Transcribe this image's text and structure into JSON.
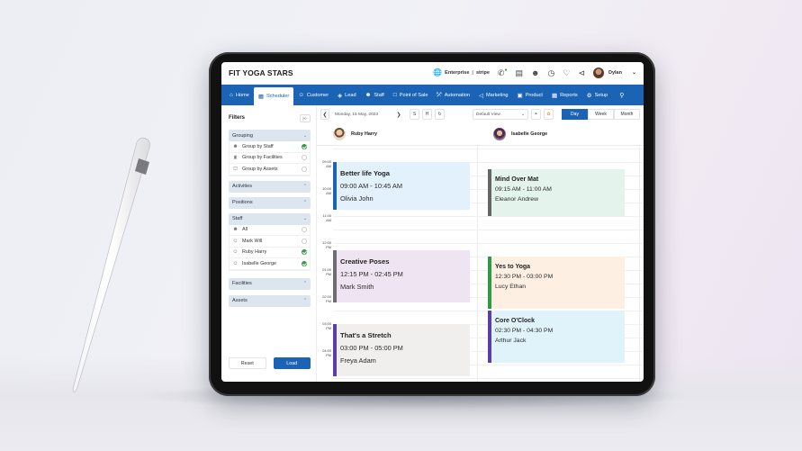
{
  "app": {
    "brand": "FIT YOGA STARS",
    "plan_label": "Enterprise",
    "payment_label": "stripe",
    "user_name": "Dylan"
  },
  "nav": {
    "items": [
      {
        "label": "Home",
        "icon": "home-icon"
      },
      {
        "label": "Scheduler",
        "icon": "calendar-icon",
        "active": true
      },
      {
        "label": "Customer",
        "icon": "user-icon"
      },
      {
        "label": "Lead",
        "icon": "lead-icon"
      },
      {
        "label": "Staff",
        "icon": "staff-icon"
      },
      {
        "label": "Point of Sale",
        "icon": "monitor-icon"
      },
      {
        "label": "Automation",
        "icon": "wand-icon"
      },
      {
        "label": "Marketing",
        "icon": "megaphone-icon"
      },
      {
        "label": "Product",
        "icon": "box-icon"
      },
      {
        "label": "Reports",
        "icon": "report-icon"
      },
      {
        "label": "Setup",
        "icon": "gear-icon"
      }
    ]
  },
  "filters": {
    "title": "Filters",
    "collapse_label": "|<-",
    "grouping": {
      "label": "Grouping",
      "options": [
        {
          "label": "Group by Staff",
          "selected": true
        },
        {
          "label": "Group by Facilities",
          "selected": false
        },
        {
          "label": "Group by Assets",
          "selected": false
        }
      ]
    },
    "activities_label": "Activities",
    "positions_label": "Positions",
    "staff": {
      "label": "Staff",
      "options": [
        {
          "label": "All",
          "selected": false
        },
        {
          "label": "Mark Will",
          "selected": false
        },
        {
          "label": "Ruby Harry",
          "selected": true
        },
        {
          "label": "Isabelle George",
          "selected": true
        }
      ]
    },
    "facilities_label": "Facilities",
    "assets_label": "Assets",
    "reset_label": "Reset",
    "load_label": "Load"
  },
  "toolbar": {
    "date": "Monday, 15 May, 2023",
    "btn_s": "S",
    "btn_h": "H",
    "view_select": "Default View",
    "views": [
      "Day",
      "Week",
      "Month"
    ],
    "active_view": "Day"
  },
  "schedule": {
    "staff": [
      "Ruby Harry",
      "Isabelle George"
    ],
    "time_labels": [
      {
        "t": "09:00",
        "p": "AM"
      },
      {
        "t": "10:00",
        "p": "AM"
      },
      {
        "t": "11:00",
        "p": "AM"
      },
      {
        "t": "12:00",
        "p": "PM"
      },
      {
        "t": "01:00",
        "p": "PM"
      },
      {
        "t": "02:00",
        "p": "PM"
      },
      {
        "t": "03:00",
        "p": "PM"
      },
      {
        "t": "04:00",
        "p": "PM"
      }
    ],
    "events": [
      {
        "staff": "Ruby Harry",
        "title": "Better life Yoga",
        "time": "09:00 AM - 10:45 AM",
        "person": "Olivia John",
        "bg": "#e3f1fc",
        "bar": "#1b63b5"
      },
      {
        "staff": "Ruby Harry",
        "title": "Creative Poses",
        "time": "12:15 PM - 02:45 PM",
        "person": "Mark Smith",
        "bg": "#efe5f2",
        "bar": "#6e6e6e"
      },
      {
        "staff": "Ruby Harry",
        "title": "That's a Stretch",
        "time": "03:00 PM - 05:00 PM",
        "person": "Freya Adam",
        "bg": "#f1efee",
        "bar": "#5b3ea6"
      },
      {
        "staff": "Isabelle George",
        "title": "Mind Over Mat",
        "time": "09:15 AM - 11:00 AM",
        "person": "Eleanor Andrew",
        "bg": "#e4f3ec",
        "bar": "#666666"
      },
      {
        "staff": "Isabelle George",
        "title": "Yes to Yoga",
        "time": "12:30 PM - 03:00 PM",
        "person": "Lucy Ethan",
        "bg": "#fdf0e3",
        "bar": "#2e9a45"
      },
      {
        "staff": "Isabelle George",
        "title": "Core O'Clock",
        "time": "02:30 PM - 04:30 PM",
        "person": "Arthur Jack",
        "bg": "#e0f3fb",
        "bar": "#5b3ea6"
      }
    ]
  }
}
